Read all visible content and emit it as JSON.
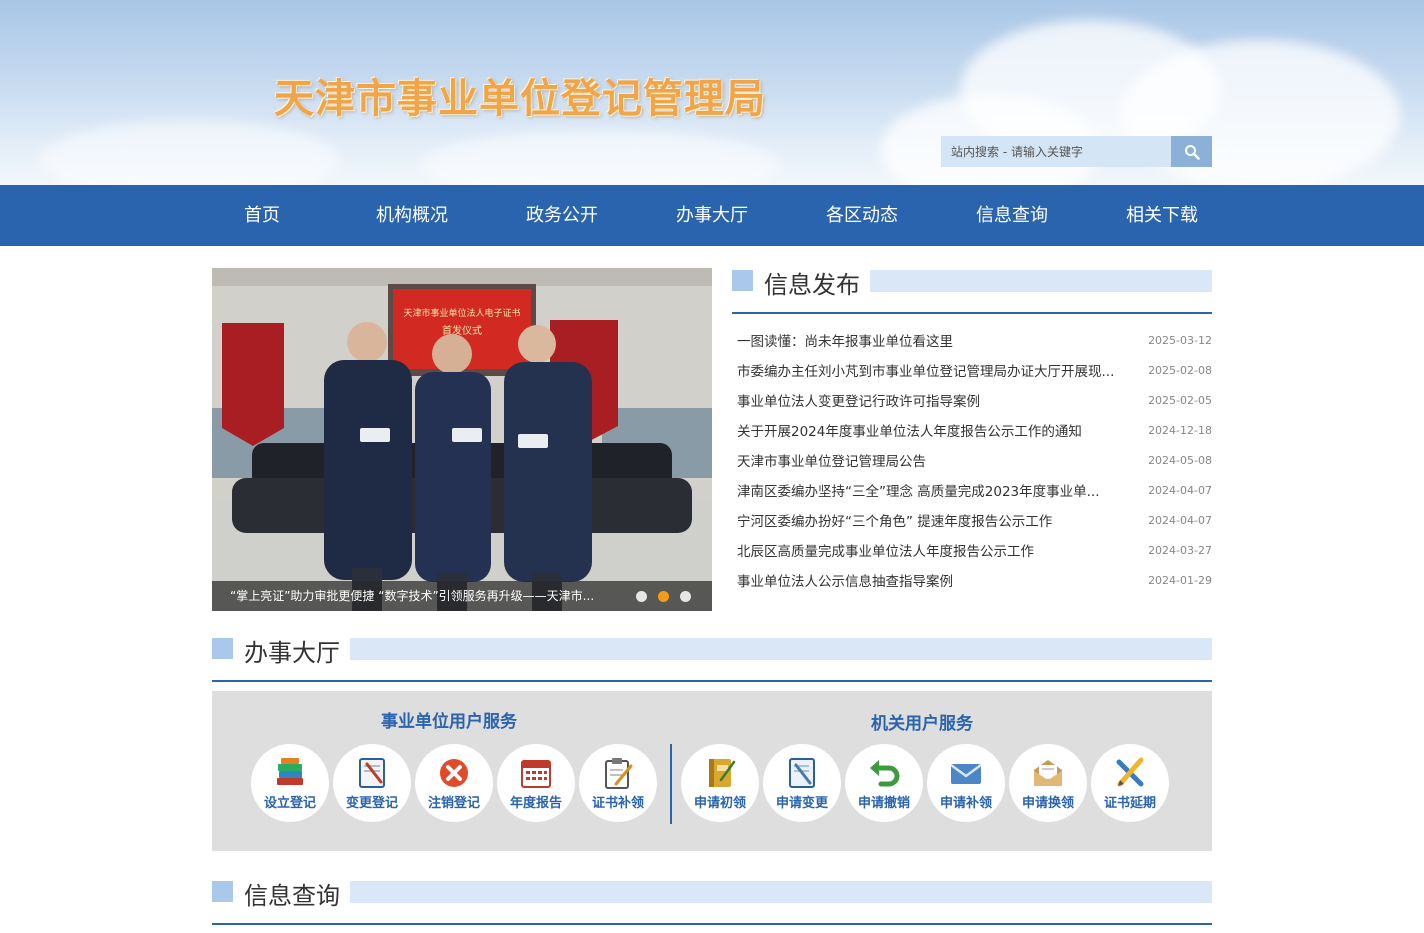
{
  "header": {
    "site_title": "天津市事业单位登记管理局",
    "search_placeholder": "站内搜索 - 请输入关键字"
  },
  "nav": {
    "items": [
      "首页",
      "机构概况",
      "政务公开",
      "办事大厅",
      "各区动态",
      "信息查询",
      "相关下载"
    ]
  },
  "slideshow": {
    "banner_line1": "天津市事业单位法人电子证书",
    "banner_line2": "首发仪式",
    "caption": "“掌上亮证”助力审批更便捷 “数字技术”引领服务再升级——天津市...",
    "slides_total": 3,
    "active_slide": 2
  },
  "info_release": {
    "title": "信息发布",
    "items": [
      {
        "title": "一图读懂：尚未年报事业单位看这里",
        "date": "2025-03-12"
      },
      {
        "title": "市委编办主任刘小芃到市事业单位登记管理局办证大厅开展现...",
        "date": "2025-02-08"
      },
      {
        "title": "事业单位法人变更登记行政许可指导案例",
        "date": "2025-02-05"
      },
      {
        "title": "关于开展2024年度事业单位法人年度报告公示工作的通知",
        "date": "2024-12-18"
      },
      {
        "title": "天津市事业单位登记管理局公告",
        "date": "2024-05-08"
      },
      {
        "title": "津南区委编办坚持“三全”理念 高质量完成2023年度事业单...",
        "date": "2024-04-07"
      },
      {
        "title": "宁河区委编办扮好“三个角色” 提速年度报告公示工作",
        "date": "2024-04-07"
      },
      {
        "title": "北辰区高质量完成事业单位法人年度报告公示工作",
        "date": "2024-03-27"
      },
      {
        "title": "事业单位法人公示信息抽查指导案例",
        "date": "2024-01-29"
      }
    ]
  },
  "service_hall": {
    "title": "办事大厅",
    "group1_title": "事业单位用户服务",
    "group2_title": "机关用户服务",
    "group1": [
      {
        "label": "设立登记",
        "icon": "books-icon"
      },
      {
        "label": "变更登记",
        "icon": "notepad-pen-icon"
      },
      {
        "label": "注销登记",
        "icon": "cancel-icon"
      },
      {
        "label": "年度报告",
        "icon": "calendar-icon"
      },
      {
        "label": "证书补领",
        "icon": "clipboard-edit-icon"
      }
    ],
    "group2": [
      {
        "label": "申请初领",
        "icon": "notebook-icon"
      },
      {
        "label": "申请变更",
        "icon": "document-pen-icon"
      },
      {
        "label": "申请撤销",
        "icon": "undo-arrow-icon"
      },
      {
        "label": "申请补领",
        "icon": "mail-icon"
      },
      {
        "label": "申请换领",
        "icon": "envelope-open-icon"
      },
      {
        "label": "证书延期",
        "icon": "pencil-ruler-icon"
      }
    ]
  },
  "info_query": {
    "title": "信息查询"
  },
  "colors": {
    "nav_bg": "#2a64ae",
    "accent_orange": "#f39b1a",
    "section_bar": "#d9e7f7",
    "title_gold": "#f0a54a"
  }
}
